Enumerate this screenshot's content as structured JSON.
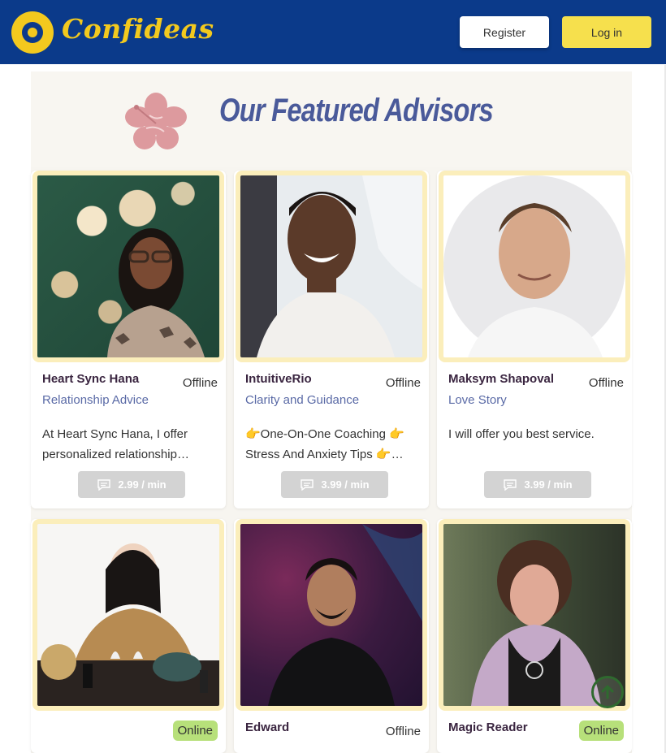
{
  "header": {
    "brand": "Confideas",
    "register_label": "Register",
    "login_label": "Log in"
  },
  "section": {
    "title": "Our Featured Advisors"
  },
  "advisors": [
    {
      "name": "Heart Sync Hana",
      "status": "Offline",
      "category": "Relationship Advice",
      "description": "At Heart Sync Hana, I offer personalized relationship…",
      "price": "2.99 / min"
    },
    {
      "name": "IntuitiveRio",
      "status": "Offline",
      "category": "Clarity and Guidance",
      "description": "👉One-On-One Coaching 👉 Stress And Anxiety Tips 👉…",
      "price": "3.99 / min"
    },
    {
      "name": "Maksym Shapoval",
      "status": "Offline",
      "category": "Love Story",
      "description": "I will offer you best service.",
      "price": "3.99 / min"
    },
    {
      "name": "",
      "status": "Online"
    },
    {
      "name": "Edward",
      "status": "Offline"
    },
    {
      "name": "Magic Reader",
      "status": "Online"
    }
  ],
  "colors": {
    "header_bg": "#0b3a8a",
    "brand_yellow": "#f3c91e",
    "login_bg": "#f6e04d",
    "title_color": "#4a5a9a",
    "category_color": "#5a6aa6",
    "online_badge": "#b7e07a",
    "photo_frame": "#fbeebb"
  },
  "icons": {
    "flower": "hibiscus-icon",
    "chat": "chat-bubble-icon",
    "scroll_top": "arrow-up-circle-icon"
  }
}
